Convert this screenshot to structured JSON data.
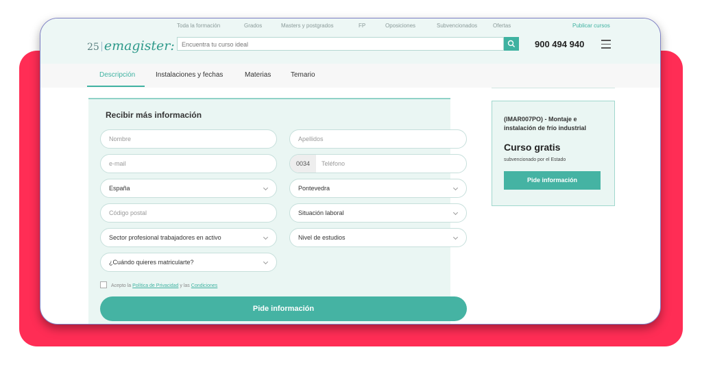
{
  "topnav": {
    "items": [
      "Toda la formación",
      "Grados",
      "Masters y postgrados",
      "FP",
      "Oposiciones",
      "Subvencionados",
      "Ofertas"
    ],
    "publish": "Publicar cursos"
  },
  "logo": {
    "number": "25",
    "brand": "emagister:"
  },
  "search": {
    "placeholder": "Encuentra tu curso ideal"
  },
  "phone": "900 494 940",
  "tabs": [
    {
      "label": "Descripción",
      "active": true
    },
    {
      "label": "Instalaciones y fechas",
      "active": false
    },
    {
      "label": "Materias",
      "active": false
    },
    {
      "label": "Temario",
      "active": false
    }
  ],
  "form": {
    "title": "Recibir más información",
    "nombre": "Nombre",
    "apellidos": "Apellidos",
    "email": "e-mail",
    "phone_prefix": "0034",
    "telefono": "Teléfono",
    "pais": "España",
    "provincia": "Pontevedra",
    "codigo_postal": "Código postal",
    "situacion": "Situación laboral",
    "sector": "Sector profesional trabajadores en activo",
    "nivel": "Nivel de estudios",
    "cuando": "¿Cuándo quieres matricularte?",
    "consent_prefix": "Acepto la ",
    "privacy_link": "Política de Privacidad",
    "consent_mid": " y las ",
    "conditions_link": "Condiciones",
    "submit": "Pide información"
  },
  "sidebar": {
    "title": "(IMAR007PO) - Montaje e instalación de frío industrial",
    "price": "Curso gratis",
    "subtitle": "subvencionado por el Estado",
    "button": "Pide información"
  },
  "colors": {
    "accent": "#3fb2a1",
    "frame": "#ff2d55",
    "panel": "#eaf6f3"
  }
}
